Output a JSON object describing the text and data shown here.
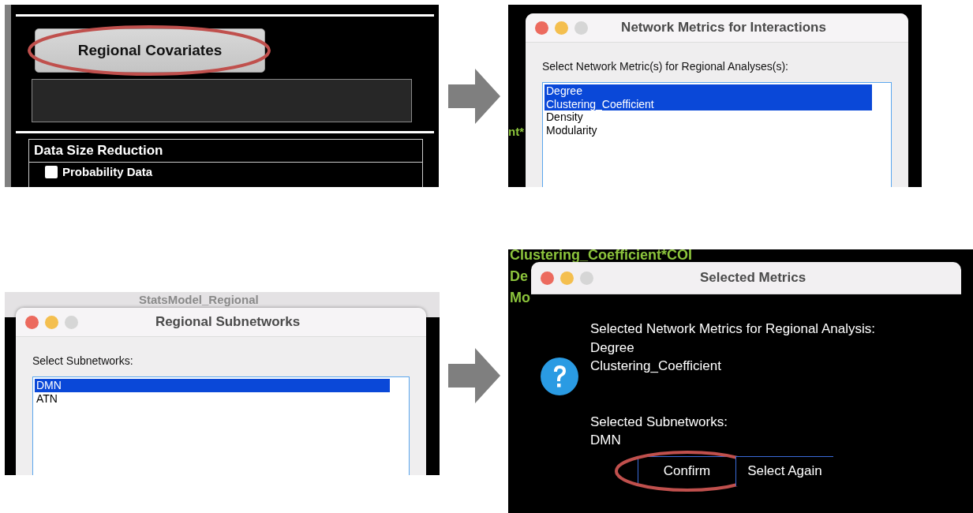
{
  "panels": [
    {
      "kind": "main",
      "button": {
        "label": "Regional Covariates",
        "highlighted": true
      },
      "section": {
        "title": "Data Size Reduction",
        "checkbox": {
          "label": "Probability Data",
          "checked": false
        }
      }
    },
    {
      "kind": "list_dialog",
      "background_texts": [
        "nt*"
      ],
      "dialog": {
        "title": "Network Metrics for Interactions",
        "prompt": "Select Network Metric(s) for Regional Analyses(s):",
        "items": [
          {
            "label": "Degree",
            "selected": true
          },
          {
            "label": "Clustering_Coefficient",
            "selected": true
          },
          {
            "label": "Density",
            "selected": false
          },
          {
            "label": "Modularity",
            "selected": false
          }
        ]
      }
    },
    {
      "kind": "list_dialog",
      "background_texts": [
        "StatsModel_Regional"
      ],
      "dialog": {
        "title": "Regional Subnetworks",
        "prompt": "Select Subnetworks:",
        "items": [
          {
            "label": "DMN",
            "selected": true
          },
          {
            "label": "ATN",
            "selected": false
          }
        ]
      }
    },
    {
      "kind": "confirm_dialog",
      "background_texts": [
        "Clustering_Coefficient*COI",
        "De",
        "Mo"
      ],
      "dialog": {
        "title": "Selected Metrics",
        "paragraphs": [
          [
            "Selected Network Metrics for Regional Analysis:",
            "Degree",
            "Clustering_Coefficient"
          ],
          [
            "Selected Subnetworks:",
            "DMN"
          ]
        ],
        "buttons": [
          {
            "label": "Confirm",
            "highlighted": true
          },
          {
            "label": "Select Again",
            "highlighted": false
          }
        ]
      }
    }
  ]
}
